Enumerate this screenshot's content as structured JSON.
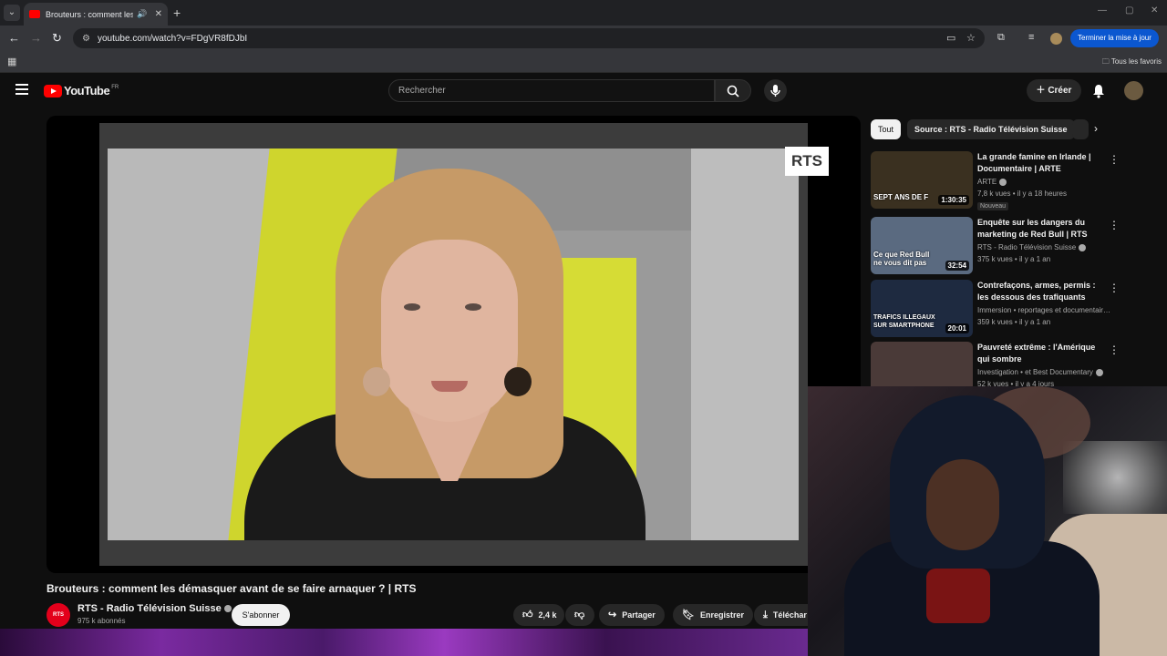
{
  "browser": {
    "tab_title": "Brouteurs : comment les dé",
    "url": "youtube.com/watch?v=FDgVR8fDJbI",
    "update_label": "Terminer la mise à jour",
    "bookmarks_label": "Tous les favoris"
  },
  "header": {
    "logo_text": "YouTube",
    "country": "FR",
    "search_placeholder": "Rechercher",
    "create_label": "Créer"
  },
  "player": {
    "watermark": "RTS"
  },
  "video": {
    "title": "Brouteurs : comment les démasquer avant de se faire arnaquer ? | RTS",
    "channel_avatar_text": "RTS",
    "channel_name": "RTS - Radio Télévision Suisse",
    "subscribers": "975 k abonnés",
    "subscribe_label": "S'abonner",
    "likes": "2,4 k",
    "share_label": "Partager",
    "save_label": "Enregistrer",
    "download_label": "Téléchar"
  },
  "sidebar": {
    "chips": [
      "Tout",
      "Source : RTS - Radio Télévision Suisse"
    ],
    "recommendations": [
      {
        "title": "La grande famine en Irlande | Documentaire | ARTE",
        "channel": "ARTE",
        "meta": "7,8 k vues • il y a 18 heures",
        "badge": "Nouveau",
        "duration": "1:30:35",
        "overlay": "SEPT ANS DE F",
        "thumb_color": "#3a3020"
      },
      {
        "title": "Enquête sur les dangers du marketing de Red Bull  | RTS",
        "channel": "RTS - Radio Télévision Suisse",
        "meta": "375 k vues • il y a 1 an",
        "duration": "32:54",
        "overlay": "Ce que Red Bull ne vous dit pas",
        "thumb_color": "#5a6a80"
      },
      {
        "title": "Contrefaçons, armes, permis : les dessous des trafiquants",
        "channel": "Immersion • reportages et documentair…",
        "meta": "359 k vues • il y a 1 an",
        "duration": "20:01",
        "overlay": "TRAFICS ILLEGAUX SUR SMARTPHONE",
        "thumb_color": "#1e2a40"
      },
      {
        "title": "Pauvreté extrême : l'Amérique qui sombre",
        "channel": "Investigation • et Best Documentary",
        "meta": "52 k vues • il y a 4 jours",
        "thumb_color": "#4a3a38"
      }
    ]
  }
}
